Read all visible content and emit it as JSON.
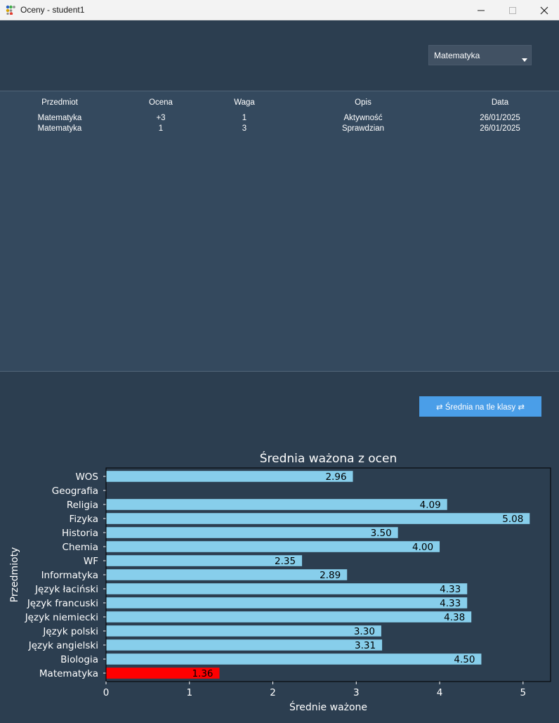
{
  "window": {
    "title": "Oceny - student1",
    "controls": [
      "minimize-icon",
      "maximize-icon",
      "close-icon"
    ]
  },
  "filter": {
    "selected_subject": "Matematyka"
  },
  "grades_table": {
    "columns": [
      "Przedmiot",
      "Ocena",
      "Waga",
      "Opis",
      "Data"
    ],
    "rows": [
      [
        "Matematyka",
        "+3",
        "1",
        "Aktywność",
        "26/01/2025"
      ],
      [
        "Matematyka",
        "1",
        "3",
        "Sprawdzian",
        "26/01/2025"
      ]
    ]
  },
  "compare_button": {
    "label": "⇄ Średnia na tle klasy ⇄"
  },
  "colors": {
    "background": "#2c3e50",
    "table_background": "#34495e",
    "button": "#4a9ee8",
    "bar": "#87ceeb",
    "highlight_bar": "#ff0000"
  },
  "chart_data": {
    "type": "bar",
    "orientation": "horizontal",
    "title": "Średnia ważona z ocen",
    "xlabel": "Średnie ważone",
    "ylabel": "Przedmioty",
    "xlim": [
      0,
      5.33
    ],
    "xticks": [
      0,
      1,
      2,
      3,
      4,
      5
    ],
    "categories": [
      "Matematyka",
      "Biologia",
      "Język angielski",
      "Język polski",
      "Język niemiecki",
      "Język francuski",
      "Język łaciński",
      "Informatyka",
      "WF",
      "Chemia",
      "Historia",
      "Fizyka",
      "Religia",
      "Geografia",
      "WOS"
    ],
    "values": [
      1.36,
      4.5,
      3.31,
      3.3,
      4.38,
      4.33,
      4.33,
      2.89,
      2.35,
      4.0,
      3.5,
      5.08,
      4.09,
      null,
      2.96
    ],
    "value_labels": [
      "1.36",
      "4.50",
      "3.31",
      "3.30",
      "4.38",
      "4.33",
      "4.33",
      "2.89",
      "2.35",
      "4.00",
      "3.50",
      "5.08",
      "4.09",
      "",
      "2.96"
    ],
    "highlighted_category": "Matematyka",
    "grid": false,
    "legend": false
  }
}
